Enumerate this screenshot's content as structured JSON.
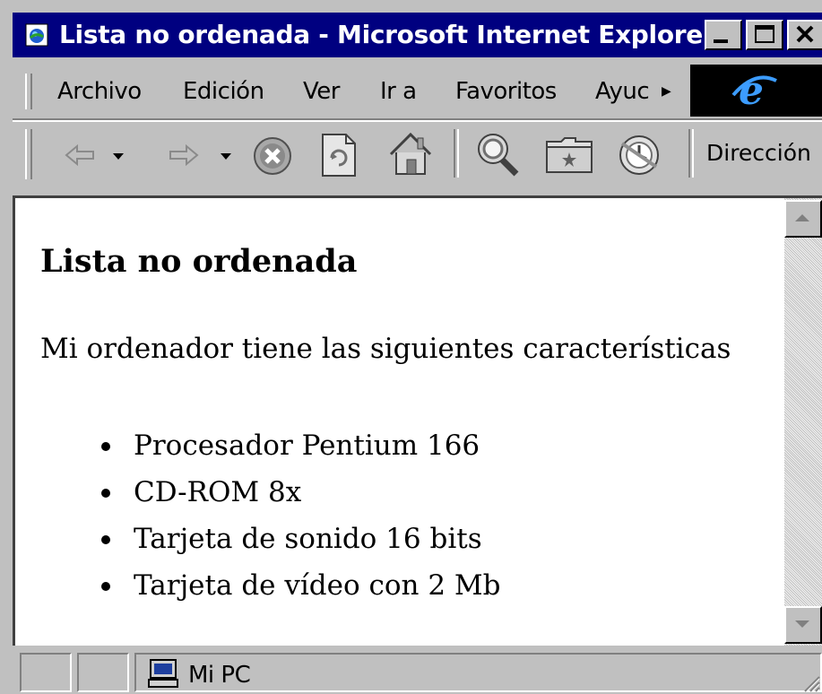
{
  "window": {
    "title": "Lista no ordenada - Microsoft Internet Explorer"
  },
  "menubar": {
    "items": [
      {
        "label": "Archivo"
      },
      {
        "label": "Edición"
      },
      {
        "label": "Ver"
      },
      {
        "label": "Ir a"
      },
      {
        "label": "Favoritos"
      },
      {
        "label": "Ayuc"
      }
    ]
  },
  "toolbar": {
    "buttons": [
      {
        "icon": "back-arrow-icon"
      },
      {
        "icon": "forward-arrow-icon"
      },
      {
        "icon": "stop-icon"
      },
      {
        "icon": "refresh-icon"
      },
      {
        "icon": "home-icon"
      },
      {
        "icon": "search-icon"
      },
      {
        "icon": "favorites-folder-icon"
      },
      {
        "icon": "history-icon"
      }
    ],
    "address_label": "Dirección"
  },
  "page": {
    "heading": "Lista no ordenada",
    "paragraph": "Mi ordenador tiene las siguientes características",
    "list": [
      "Procesador Pentium 166",
      "CD-ROM 8x",
      "Tarjeta de sonido 16 bits",
      "Tarjeta de vídeo con 2 Mb"
    ]
  },
  "statusbar": {
    "zone": "Mi PC"
  },
  "colors": {
    "titlebar": "#000080",
    "chrome": "#c0c0c0",
    "content_bg": "#ffffff"
  }
}
